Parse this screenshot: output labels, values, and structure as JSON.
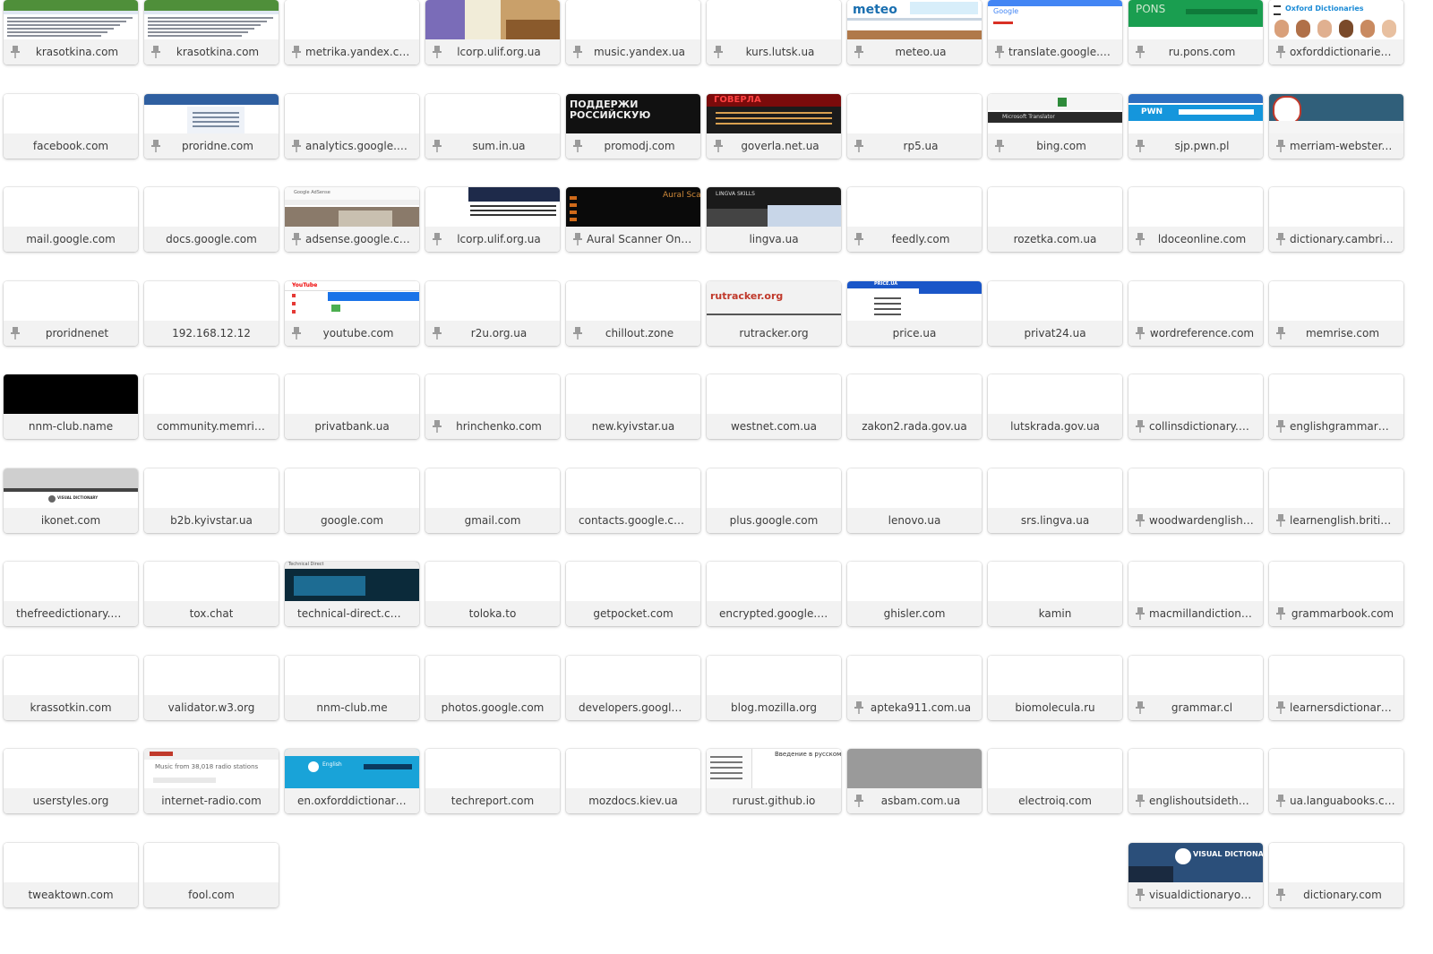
{
  "colors": {
    "caption_bg": "#f2f2f2",
    "caption_text": "#3d3d3d",
    "tile_bg": "#ffffff",
    "pin": "#9a9a9a"
  },
  "tiles": [
    {
      "label": "krasotkina.com",
      "pinned": true,
      "thumb": "krasotkina"
    },
    {
      "label": "krasotkina.com",
      "pinned": true,
      "thumb": "krasotkina"
    },
    {
      "label": "metrika.yandex.com",
      "pinned": true,
      "thumb": "blank"
    },
    {
      "label": "lcorp.ulif.org.ua",
      "pinned": true,
      "thumb": "lcorp"
    },
    {
      "label": "music.yandex.ua",
      "pinned": true,
      "thumb": "blank"
    },
    {
      "label": "kurs.lutsk.ua",
      "pinned": true,
      "thumb": "blank"
    },
    {
      "label": "meteo.ua",
      "pinned": true,
      "thumb": "meteo",
      "thumb_text": "meteo"
    },
    {
      "label": "translate.google.com",
      "pinned": true,
      "thumb": "translate",
      "thumb_text": "Google"
    },
    {
      "label": "ru.pons.com",
      "pinned": true,
      "thumb": "pons",
      "thumb_text": "PONS"
    },
    {
      "label": "oxforddictionaries.c...",
      "pinned": true,
      "thumb": "oxford",
      "thumb_text": "Oxford Dictionaries"
    },
    {
      "label": "facebook.com",
      "pinned": false,
      "thumb": "blank"
    },
    {
      "label": "proridne.com",
      "pinned": true,
      "thumb": "proridne"
    },
    {
      "label": "analytics.google.com",
      "pinned": true,
      "thumb": "blank"
    },
    {
      "label": "sum.in.ua",
      "pinned": true,
      "thumb": "blank"
    },
    {
      "label": "promodj.com",
      "pinned": true,
      "thumb": "promodj",
      "thumb_text": "ПОДДЕРЖИ РОССИЙСКУЮ"
    },
    {
      "label": "goverla.net.ua",
      "pinned": true,
      "thumb": "goverla",
      "thumb_text": "ГОВЕРЛА"
    },
    {
      "label": "rp5.ua",
      "pinned": true,
      "thumb": "blank"
    },
    {
      "label": "bing.com",
      "pinned": true,
      "thumb": "bing",
      "thumb_text": "Microsoft Translator"
    },
    {
      "label": "sjp.pwn.pl",
      "pinned": true,
      "thumb": "pwn",
      "thumb_text": "PWN"
    },
    {
      "label": "merriam-webster.c...",
      "pinned": true,
      "thumb": "merriam"
    },
    {
      "label": "mail.google.com",
      "pinned": false,
      "thumb": "blank"
    },
    {
      "label": "docs.google.com",
      "pinned": false,
      "thumb": "blank"
    },
    {
      "label": "adsense.google.com",
      "pinned": true,
      "thumb": "adsense",
      "thumb_text": "Google AdSense"
    },
    {
      "label": "lcorp.ulif.org.ua",
      "pinned": true,
      "thumb": "lcorp2"
    },
    {
      "label": "Aural Scanner Onlin...",
      "pinned": true,
      "thumb": "aural",
      "thumb_text": "Aural Scar"
    },
    {
      "label": "lingva.ua",
      "pinned": false,
      "thumb": "lingva",
      "thumb_text": "LINGVA SKILLS"
    },
    {
      "label": "feedly.com",
      "pinned": true,
      "thumb": "blank"
    },
    {
      "label": "rozetka.com.ua",
      "pinned": false,
      "thumb": "blank"
    },
    {
      "label": "ldoceonline.com",
      "pinned": true,
      "thumb": "blank"
    },
    {
      "label": "dictionary.cambrid...",
      "pinned": true,
      "thumb": "blank"
    },
    {
      "label": "proridnenet",
      "pinned": true,
      "thumb": "blank"
    },
    {
      "label": "192.168.12.12",
      "pinned": false,
      "thumb": "blank"
    },
    {
      "label": "youtube.com",
      "pinned": true,
      "thumb": "youtube",
      "thumb_text": "YouTube"
    },
    {
      "label": "r2u.org.ua",
      "pinned": true,
      "thumb": "blank"
    },
    {
      "label": "chillout.zone",
      "pinned": true,
      "thumb": "blank"
    },
    {
      "label": "rutracker.org",
      "pinned": false,
      "thumb": "rutracker",
      "thumb_text": "rutracker.org"
    },
    {
      "label": "price.ua",
      "pinned": false,
      "thumb": "price",
      "thumb_text": "PRICE.UA"
    },
    {
      "label": "privat24.ua",
      "pinned": false,
      "thumb": "blank"
    },
    {
      "label": "wordreference.com",
      "pinned": true,
      "thumb": "blank"
    },
    {
      "label": "memrise.com",
      "pinned": true,
      "thumb": "blank"
    },
    {
      "label": "nnm-club.name",
      "pinned": false,
      "thumb": "black"
    },
    {
      "label": "community.memrise.com",
      "pinned": false,
      "thumb": "blank"
    },
    {
      "label": "privatbank.ua",
      "pinned": false,
      "thumb": "blank"
    },
    {
      "label": "hrinchenko.com",
      "pinned": true,
      "thumb": "blank"
    },
    {
      "label": "new.kyivstar.ua",
      "pinned": false,
      "thumb": "blank"
    },
    {
      "label": "westnet.com.ua",
      "pinned": false,
      "thumb": "blank"
    },
    {
      "label": "zakon2.rada.gov.ua",
      "pinned": false,
      "thumb": "blank"
    },
    {
      "label": "lutskrada.gov.ua",
      "pinned": false,
      "thumb": "blank"
    },
    {
      "label": "collinsdictionary.com",
      "pinned": true,
      "thumb": "blank"
    },
    {
      "label": "englishgrammar10...",
      "pinned": true,
      "thumb": "blank"
    },
    {
      "label": "ikonet.com",
      "pinned": false,
      "thumb": "ikonet",
      "thumb_text": "VISUAL DICTIONARY"
    },
    {
      "label": "b2b.kyivstar.ua",
      "pinned": false,
      "thumb": "blank"
    },
    {
      "label": "google.com",
      "pinned": false,
      "thumb": "blank"
    },
    {
      "label": "gmail.com",
      "pinned": false,
      "thumb": "blank"
    },
    {
      "label": "contacts.google.com",
      "pinned": false,
      "thumb": "blank"
    },
    {
      "label": "plus.google.com",
      "pinned": false,
      "thumb": "blank"
    },
    {
      "label": "lenovo.ua",
      "pinned": false,
      "thumb": "blank"
    },
    {
      "label": "srs.lingva.ua",
      "pinned": false,
      "thumb": "blank"
    },
    {
      "label": "woodwardenglish.c...",
      "pinned": true,
      "thumb": "blank"
    },
    {
      "label": "learnenglish.britishc...",
      "pinned": true,
      "thumb": "blank"
    },
    {
      "label": "thefreedictionary.com",
      "pinned": false,
      "thumb": "blank"
    },
    {
      "label": "tox.chat",
      "pinned": false,
      "thumb": "blank"
    },
    {
      "label": "technical-direct.com",
      "pinned": false,
      "thumb": "technical",
      "thumb_text": "Technical Direct"
    },
    {
      "label": "toloka.to",
      "pinned": false,
      "thumb": "blank"
    },
    {
      "label": "getpocket.com",
      "pinned": false,
      "thumb": "blank"
    },
    {
      "label": "encrypted.google.com",
      "pinned": false,
      "thumb": "blank"
    },
    {
      "label": "ghisler.com",
      "pinned": false,
      "thumb": "blank"
    },
    {
      "label": "kamin",
      "pinned": false,
      "thumb": "blank"
    },
    {
      "label": "macmillandictionary...",
      "pinned": true,
      "thumb": "blank"
    },
    {
      "label": "grammarbook.com",
      "pinned": true,
      "thumb": "blank"
    },
    {
      "label": "krassotkin.com",
      "pinned": false,
      "thumb": "blank"
    },
    {
      "label": "validator.w3.org",
      "pinned": false,
      "thumb": "blank"
    },
    {
      "label": "nnm-club.me",
      "pinned": false,
      "thumb": "blank"
    },
    {
      "label": "photos.google.com",
      "pinned": false,
      "thumb": "blank"
    },
    {
      "label": "developers.google.com",
      "pinned": false,
      "thumb": "blank"
    },
    {
      "label": "blog.mozilla.org",
      "pinned": false,
      "thumb": "blank"
    },
    {
      "label": "apteka911.com.ua",
      "pinned": true,
      "thumb": "blank"
    },
    {
      "label": "biomolecula.ru",
      "pinned": false,
      "thumb": "blank"
    },
    {
      "label": "grammar.cl",
      "pinned": true,
      "thumb": "blank"
    },
    {
      "label": "learnersdictionary.c...",
      "pinned": true,
      "thumb": "blank"
    },
    {
      "label": "userstyles.org",
      "pinned": false,
      "thumb": "blank"
    },
    {
      "label": "internet-radio.com",
      "pinned": false,
      "thumb": "radio",
      "thumb_text": "Music from 38,018 radio stations"
    },
    {
      "label": "en.oxforddictionaries.c...",
      "pinned": false,
      "thumb": "enoxford",
      "thumb_text": "English"
    },
    {
      "label": "techreport.com",
      "pinned": false,
      "thumb": "blank"
    },
    {
      "label": "mozdocs.kiev.ua",
      "pinned": false,
      "thumb": "blank"
    },
    {
      "label": "rurust.github.io",
      "pinned": false,
      "thumb": "rurust",
      "thumb_text": "Введение в русском"
    },
    {
      "label": "asbam.com.ua",
      "pinned": true,
      "thumb": "gray"
    },
    {
      "label": "electroiq.com",
      "pinned": false,
      "thumb": "blank"
    },
    {
      "label": "englishoutsidetheb...",
      "pinned": true,
      "thumb": "blank"
    },
    {
      "label": "ua.languabooks.com",
      "pinned": true,
      "thumb": "blank"
    },
    {
      "label": "tweaktown.com",
      "pinned": false,
      "thumb": "blank"
    },
    {
      "label": "fool.com",
      "pinned": false,
      "thumb": "blank"
    },
    null,
    null,
    null,
    null,
    null,
    null,
    {
      "label": "visualdictionaryonli...",
      "pinned": true,
      "thumb": "visualdict",
      "thumb_text": "VISUAL DICTIONARY"
    },
    {
      "label": "dictionary.com",
      "pinned": true,
      "thumb": "blank"
    }
  ]
}
